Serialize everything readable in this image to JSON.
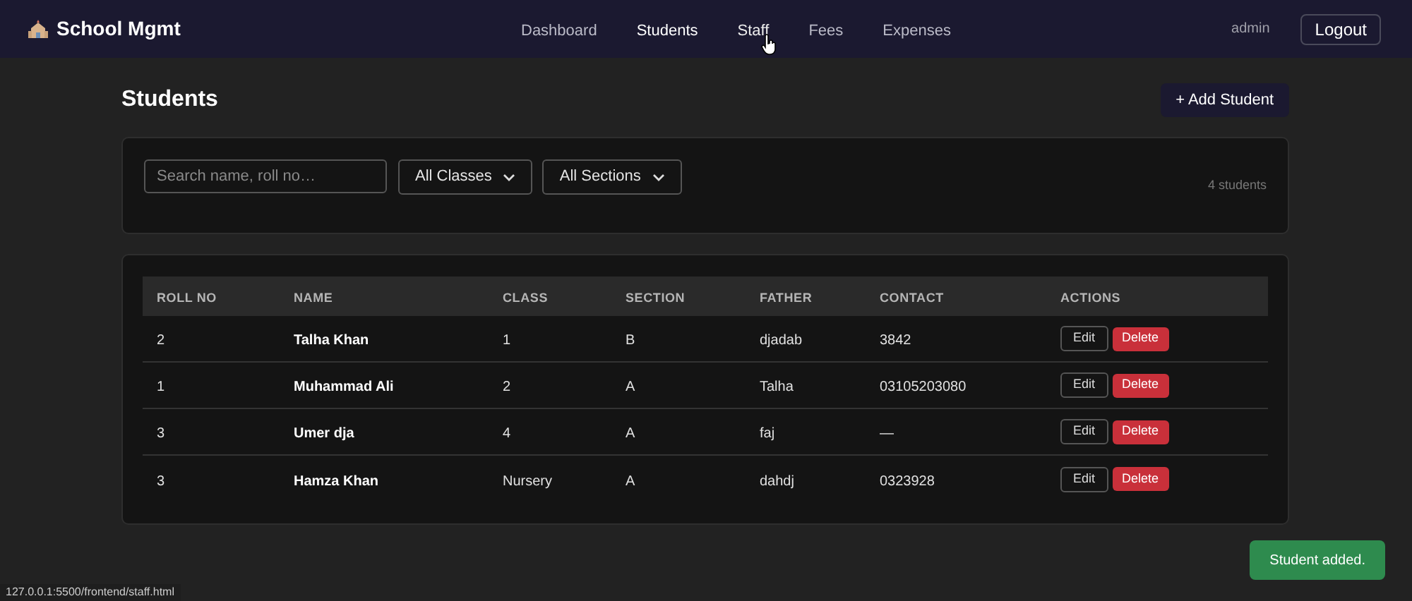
{
  "brand": {
    "title": "School Mgmt"
  },
  "nav": [
    {
      "label": "Dashboard",
      "selected": false,
      "hovered": false
    },
    {
      "label": "Students",
      "selected": true,
      "hovered": false
    },
    {
      "label": "Staff",
      "selected": false,
      "hovered": true
    },
    {
      "label": "Fees",
      "selected": false,
      "hovered": false
    },
    {
      "label": "Expenses",
      "selected": false,
      "hovered": false
    }
  ],
  "user": "admin",
  "logout": "Logout",
  "page_title": "Students",
  "add_button": "+ Add Student",
  "filters": {
    "search_placeholder": "Search name, roll no…",
    "class_select": "All Classes",
    "section_select": "All Sections",
    "count": "4 students"
  },
  "table": {
    "columns": [
      "ROLL NO",
      "NAME",
      "CLASS",
      "SECTION",
      "FATHER",
      "CONTACT",
      "ACTIONS"
    ],
    "rows": [
      {
        "roll": "2",
        "name": "Talha Khan",
        "class": "1",
        "section": "B",
        "father": "djadab",
        "contact": "3842",
        "edit": "Edit",
        "delete": "Delete"
      },
      {
        "roll": "1",
        "name": "Muhammad Ali",
        "class": "2",
        "section": "A",
        "father": "Talha",
        "contact": "03105203080",
        "edit": "Edit",
        "delete": "Delete"
      },
      {
        "roll": "3",
        "name": "Umer dja",
        "class": "4",
        "section": "A",
        "father": "faj",
        "contact": "—",
        "edit": "Edit",
        "delete": "Delete"
      },
      {
        "roll": "3",
        "name": "Hamza Khan",
        "class": "Nursery",
        "section": "A",
        "father": "dahdj",
        "contact": "0323928",
        "edit": "Edit",
        "delete": "Delete"
      }
    ]
  },
  "toast": "Student added.",
  "status_url": "127.0.0.1:5500/frontend/staff.html"
}
